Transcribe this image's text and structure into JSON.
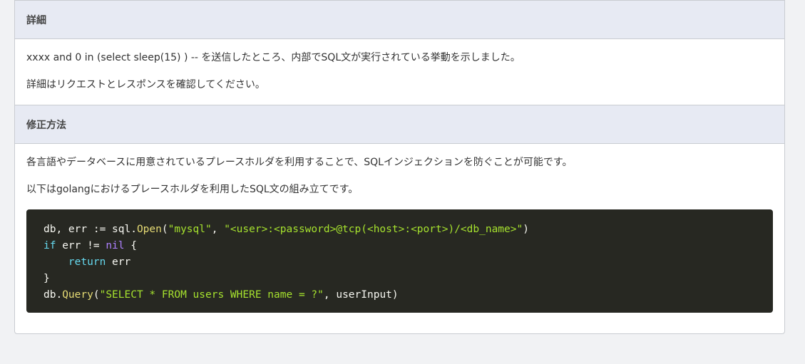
{
  "sections": {
    "details": {
      "title": "詳細",
      "paragraphs": [
        "xxxx and 0 in (select sleep(15) ) -- を送信したところ、内部でSQL文が実行されている挙動を示しました。",
        "詳細はリクエストとレスポンスを確認してください。"
      ]
    },
    "fix": {
      "title": "修正方法",
      "paragraphs": [
        "各言語やデータベースに用意されているプレースホルダを利用することで、SQLインジェクションを防ぐことが可能です。",
        "以下はgolangにおけるプレースホルダを利用したSQL文の組み立てです。"
      ]
    }
  },
  "code": {
    "lines": [
      [
        {
          "t": "db, err := sql.",
          "c": "default"
        },
        {
          "t": "Open",
          "c": "func"
        },
        {
          "t": "(",
          "c": "punct"
        },
        {
          "t": "\"mysql\"",
          "c": "string"
        },
        {
          "t": ", ",
          "c": "punct"
        },
        {
          "t": "\"<user>:<password>@tcp(<host>:<port>)/<db_name>\"",
          "c": "string"
        },
        {
          "t": ")",
          "c": "punct"
        }
      ],
      [
        {
          "t": "if",
          "c": "keyword"
        },
        {
          "t": " err != ",
          "c": "default"
        },
        {
          "t": "nil",
          "c": "const"
        },
        {
          "t": " {",
          "c": "punct"
        }
      ],
      [
        {
          "t": "    ",
          "c": "default"
        },
        {
          "t": "return",
          "c": "keyword"
        },
        {
          "t": " err",
          "c": "default"
        }
      ],
      [
        {
          "t": "}",
          "c": "punct"
        }
      ],
      [
        {
          "t": "db.",
          "c": "default"
        },
        {
          "t": "Query",
          "c": "func"
        },
        {
          "t": "(",
          "c": "punct"
        },
        {
          "t": "\"SELECT * FROM users WHERE name = ?\"",
          "c": "string"
        },
        {
          "t": ", userInput)",
          "c": "default"
        }
      ]
    ]
  },
  "colors": {
    "header_bg": "#e7eaf3",
    "code_bg": "#272822",
    "string": "#a6e22e",
    "func": "#e6db74",
    "keyword": "#66d9ef",
    "const": "#ae81ff"
  }
}
